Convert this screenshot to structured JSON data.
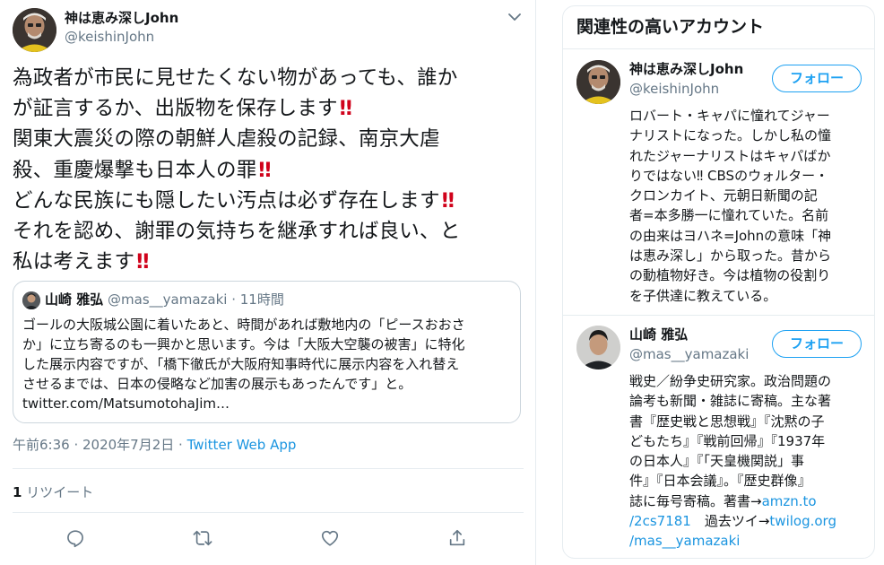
{
  "tweet": {
    "author": {
      "name": "神は恵み深しJohn",
      "handle": "@keishinJohn"
    },
    "text_lines": [
      "為政者が市民に見せたくない物があっても、誰か",
      "が証言するか、出版物を保存します",
      "関東大震災の際の朝鮮人虐殺の記録、南京大虐",
      "殺、重慶爆撃も日本人の罪",
      "どんな民族にも隠したい汚点は必ず存在します",
      "それを認め、謝罪の気持ちを継承すれば良い、と",
      "私は考えます"
    ],
    "emphasis_mark": "‼",
    "quote": {
      "name": "山崎 雅弘",
      "handle_time": "@mas__yamazaki · 11時間",
      "body_lines": [
        "ゴールの大阪城公園に着いたあと、時間があれば敷地内の「ピースおおさ",
        "か」に立ち寄るのも一興かと思います。今は「大阪大空襲の被害」に特化",
        "した展示内容ですが、「橋下徹氏が大阪府知事時代に展示内容を入れ替え",
        "させるまでは、日本の侵略など加害の展示もあったんです」と。",
        "twitter.com/MatsumotohaJim…"
      ]
    },
    "timestamp": "午前6:36 · 2020年7月2日 · ",
    "source": "Twitter Web App",
    "retweet_count": "1",
    "retweet_label": " リツイート",
    "icons": {
      "caret": "chevron-down-icon",
      "reply": "reply-icon",
      "retweet": "retweet-icon",
      "like": "like-icon",
      "share": "share-icon"
    }
  },
  "sidebar": {
    "title": "関連性の高いアカウント",
    "follow_label": "フォロー",
    "accounts": [
      {
        "name": "神は恵み深しJohn",
        "handle": "@keishinJohn",
        "bio_lines": [
          "ロバート・キャパに憧れてジャー",
          "ナリストになった。しかし私の憧",
          "れたジャーナリストはキャパばか",
          "りではない‼ CBSのウォルター・",
          "クロンカイト、元朝日新聞の記",
          "者=本多勝一に憧れていた。名前",
          "の由来はヨハネ=Johnの意味「神",
          "は恵み深し」から取った。昔から",
          "の動植物好き。今は植物の役割り",
          "を子供達に教えている。"
        ]
      },
      {
        "name": "山崎 雅弘",
        "handle": "@mas__yamazaki",
        "bio_lines": [
          "戦史／紛争史研究家。政治問題の",
          "論考も新聞・雑誌に寄稿。主な著",
          "書『歴史戦と思想戦』『沈黙の子",
          "どもたち』『戦前回帰』『1937年",
          "の日本人』『「天皇機関説」事",
          "件』『日本会議』。『歴史群像』",
          "誌に毎号寄稿。著書→"
        ],
        "bio_link_1": "amzn.to",
        "bio_line_8_link": "/2cs7181",
        "bio_line_8_text": "　過去ツイ→",
        "bio_link_2": "twilog.org",
        "bio_line_9_link": "/mas__yamazaki"
      }
    ]
  },
  "colors": {
    "text": "#14171a",
    "muted": "#657786",
    "accent": "#1da1f2",
    "link": "#1b95e0",
    "emphasis": "#d0021b",
    "border": "#e6ecf0"
  }
}
